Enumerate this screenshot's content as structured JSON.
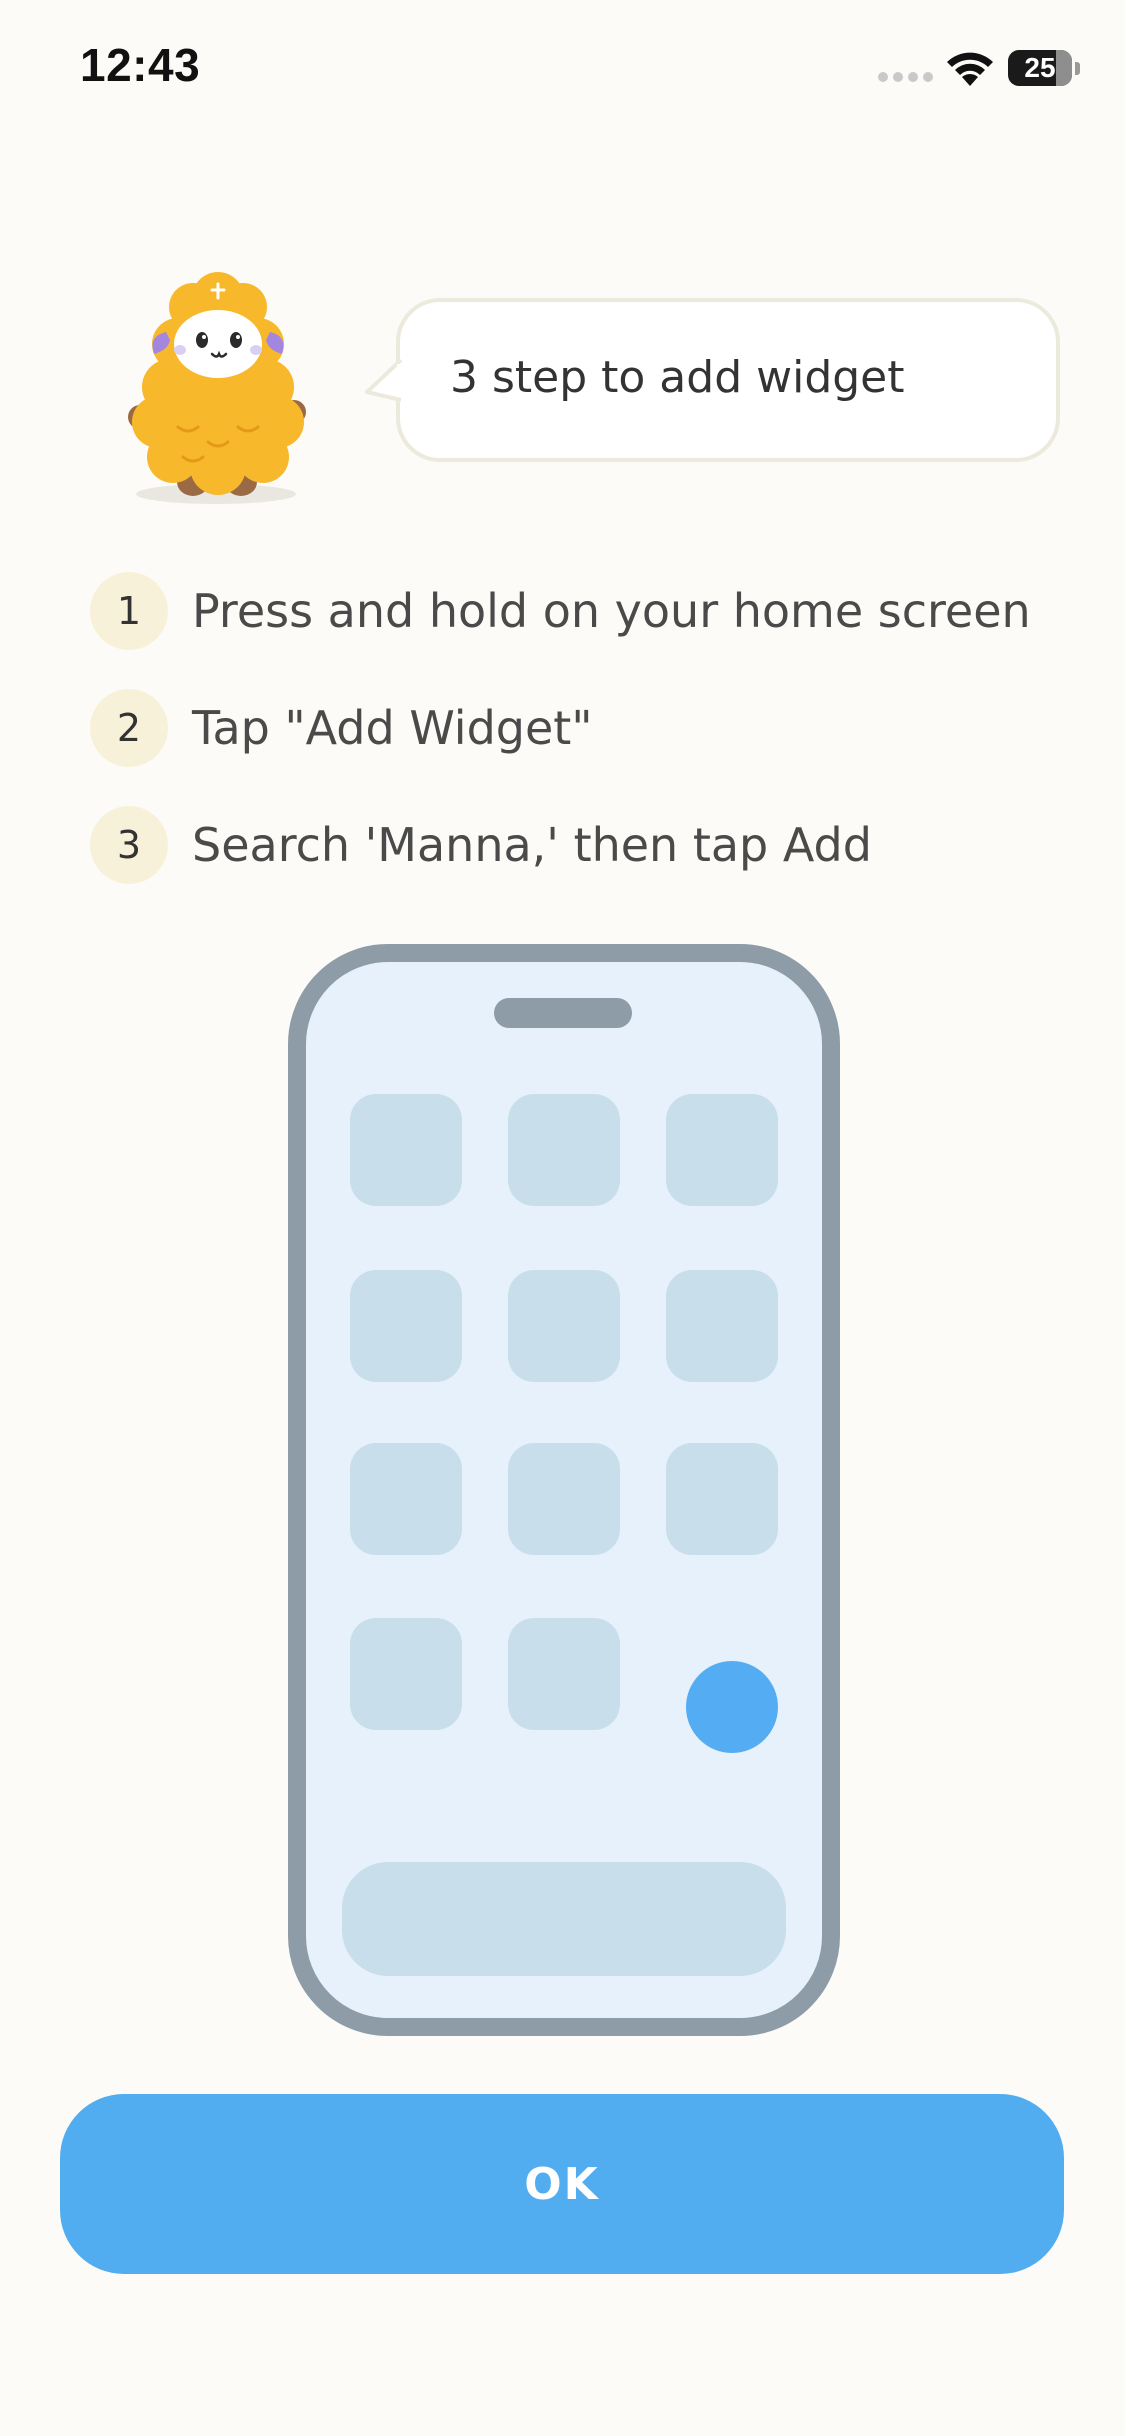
{
  "status_bar": {
    "time": "12:43",
    "battery_level": "25",
    "battery_fraction": 0.25,
    "icons": [
      "cellular-signal-icon",
      "wifi-icon",
      "battery-icon"
    ]
  },
  "mascot": {
    "icon": "sheep-mascot"
  },
  "bubble": {
    "text": "3 step to add widget"
  },
  "steps": [
    {
      "number": "1",
      "text": "Press and hold on your home screen"
    },
    {
      "number": "2",
      "text": "Tap \"Add Widget\""
    },
    {
      "number": "3",
      "text": "Search 'Manna,' then tap Add"
    }
  ],
  "illustration": {
    "icon": "phone-home-screen",
    "app_tile_count": 11
  },
  "ok_button": {
    "label": "OK"
  },
  "colors": {
    "background": "#FCFBF7",
    "accent": "#52ADF0",
    "step_badge": "#F8F1DA",
    "phone_frame": "#8E9CA7",
    "phone_screen": "#E6F1FB",
    "app_tile": "#C8DEEB",
    "mascot_wool": "#F7B82B"
  }
}
